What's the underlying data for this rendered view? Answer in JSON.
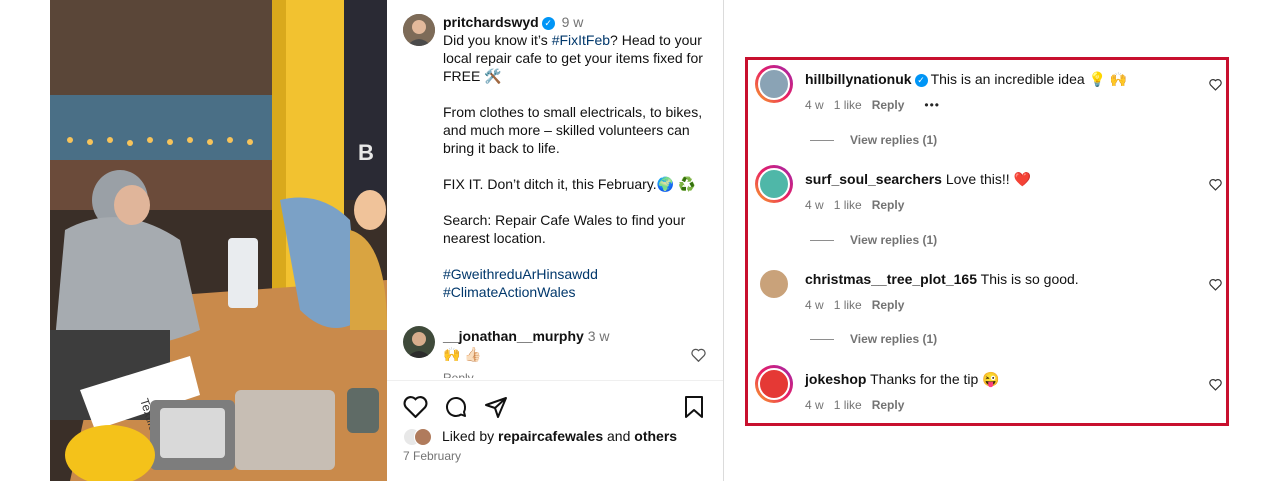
{
  "post": {
    "author": "pritchardswyd",
    "time": "9 w",
    "caption_lines": [
      "Did you know it’s ",
      "#FixItFeb",
      "? Head to your local repair cafe to get your items fixed for FREE 🛠️",
      "From clothes to small electricals, to bikes, and much more – skilled volunteers can bring it back to life.",
      "FIX IT. Don’t ditch it, this February.🌍 ♻️",
      "Search: Repair Cafe Wales to find your nearest location."
    ],
    "hashtags": [
      "#GweithreduArHinsawdd",
      "#ClimateActionWales"
    ],
    "top_comment": {
      "username": "__jonathan__murphy",
      "time": "3 w",
      "text": "🙌 👍🏻",
      "reply_label": "Reply"
    },
    "liked_by_prefix": "Liked by ",
    "liked_by_user": "repaircafewales",
    "liked_by_mid": " and ",
    "liked_by_others": "others",
    "date": "7 February"
  },
  "photo": {
    "sign_text": "Textiles",
    "wall_letter": "B"
  },
  "comments": [
    {
      "username": "hillbillynationuk",
      "verified": true,
      "text": "This is an incredible idea 💡 🙌",
      "time": "4 w",
      "likes": "1 like",
      "reply_label": "Reply",
      "more": "•••",
      "view_replies": "View replies (1)",
      "avatar_color": "#8aa3b5"
    },
    {
      "username": "surf_soul_searchers",
      "verified": false,
      "text": "Love this!! ❤️",
      "time": "4 w",
      "likes": "1 like",
      "reply_label": "Reply",
      "view_replies": "View replies (1)",
      "avatar_color": "#4fb7a8"
    },
    {
      "username": "christmas__tree_plot_165",
      "verified": false,
      "text": "This is so good.",
      "time": "4 w",
      "likes": "1 like",
      "reply_label": "Reply",
      "view_replies": "View replies (1)",
      "avatar_color": "#c9a27a"
    },
    {
      "username": "jokeshop",
      "verified": false,
      "text": "Thanks for the tip 😜",
      "time": "4 w",
      "likes": "1 like",
      "reply_label": "Reply",
      "avatar_color": "#e53935"
    }
  ],
  "colors": {
    "highlight_border": "#c8102e",
    "hashtag": "#00376b",
    "verified": "#0095f6"
  }
}
